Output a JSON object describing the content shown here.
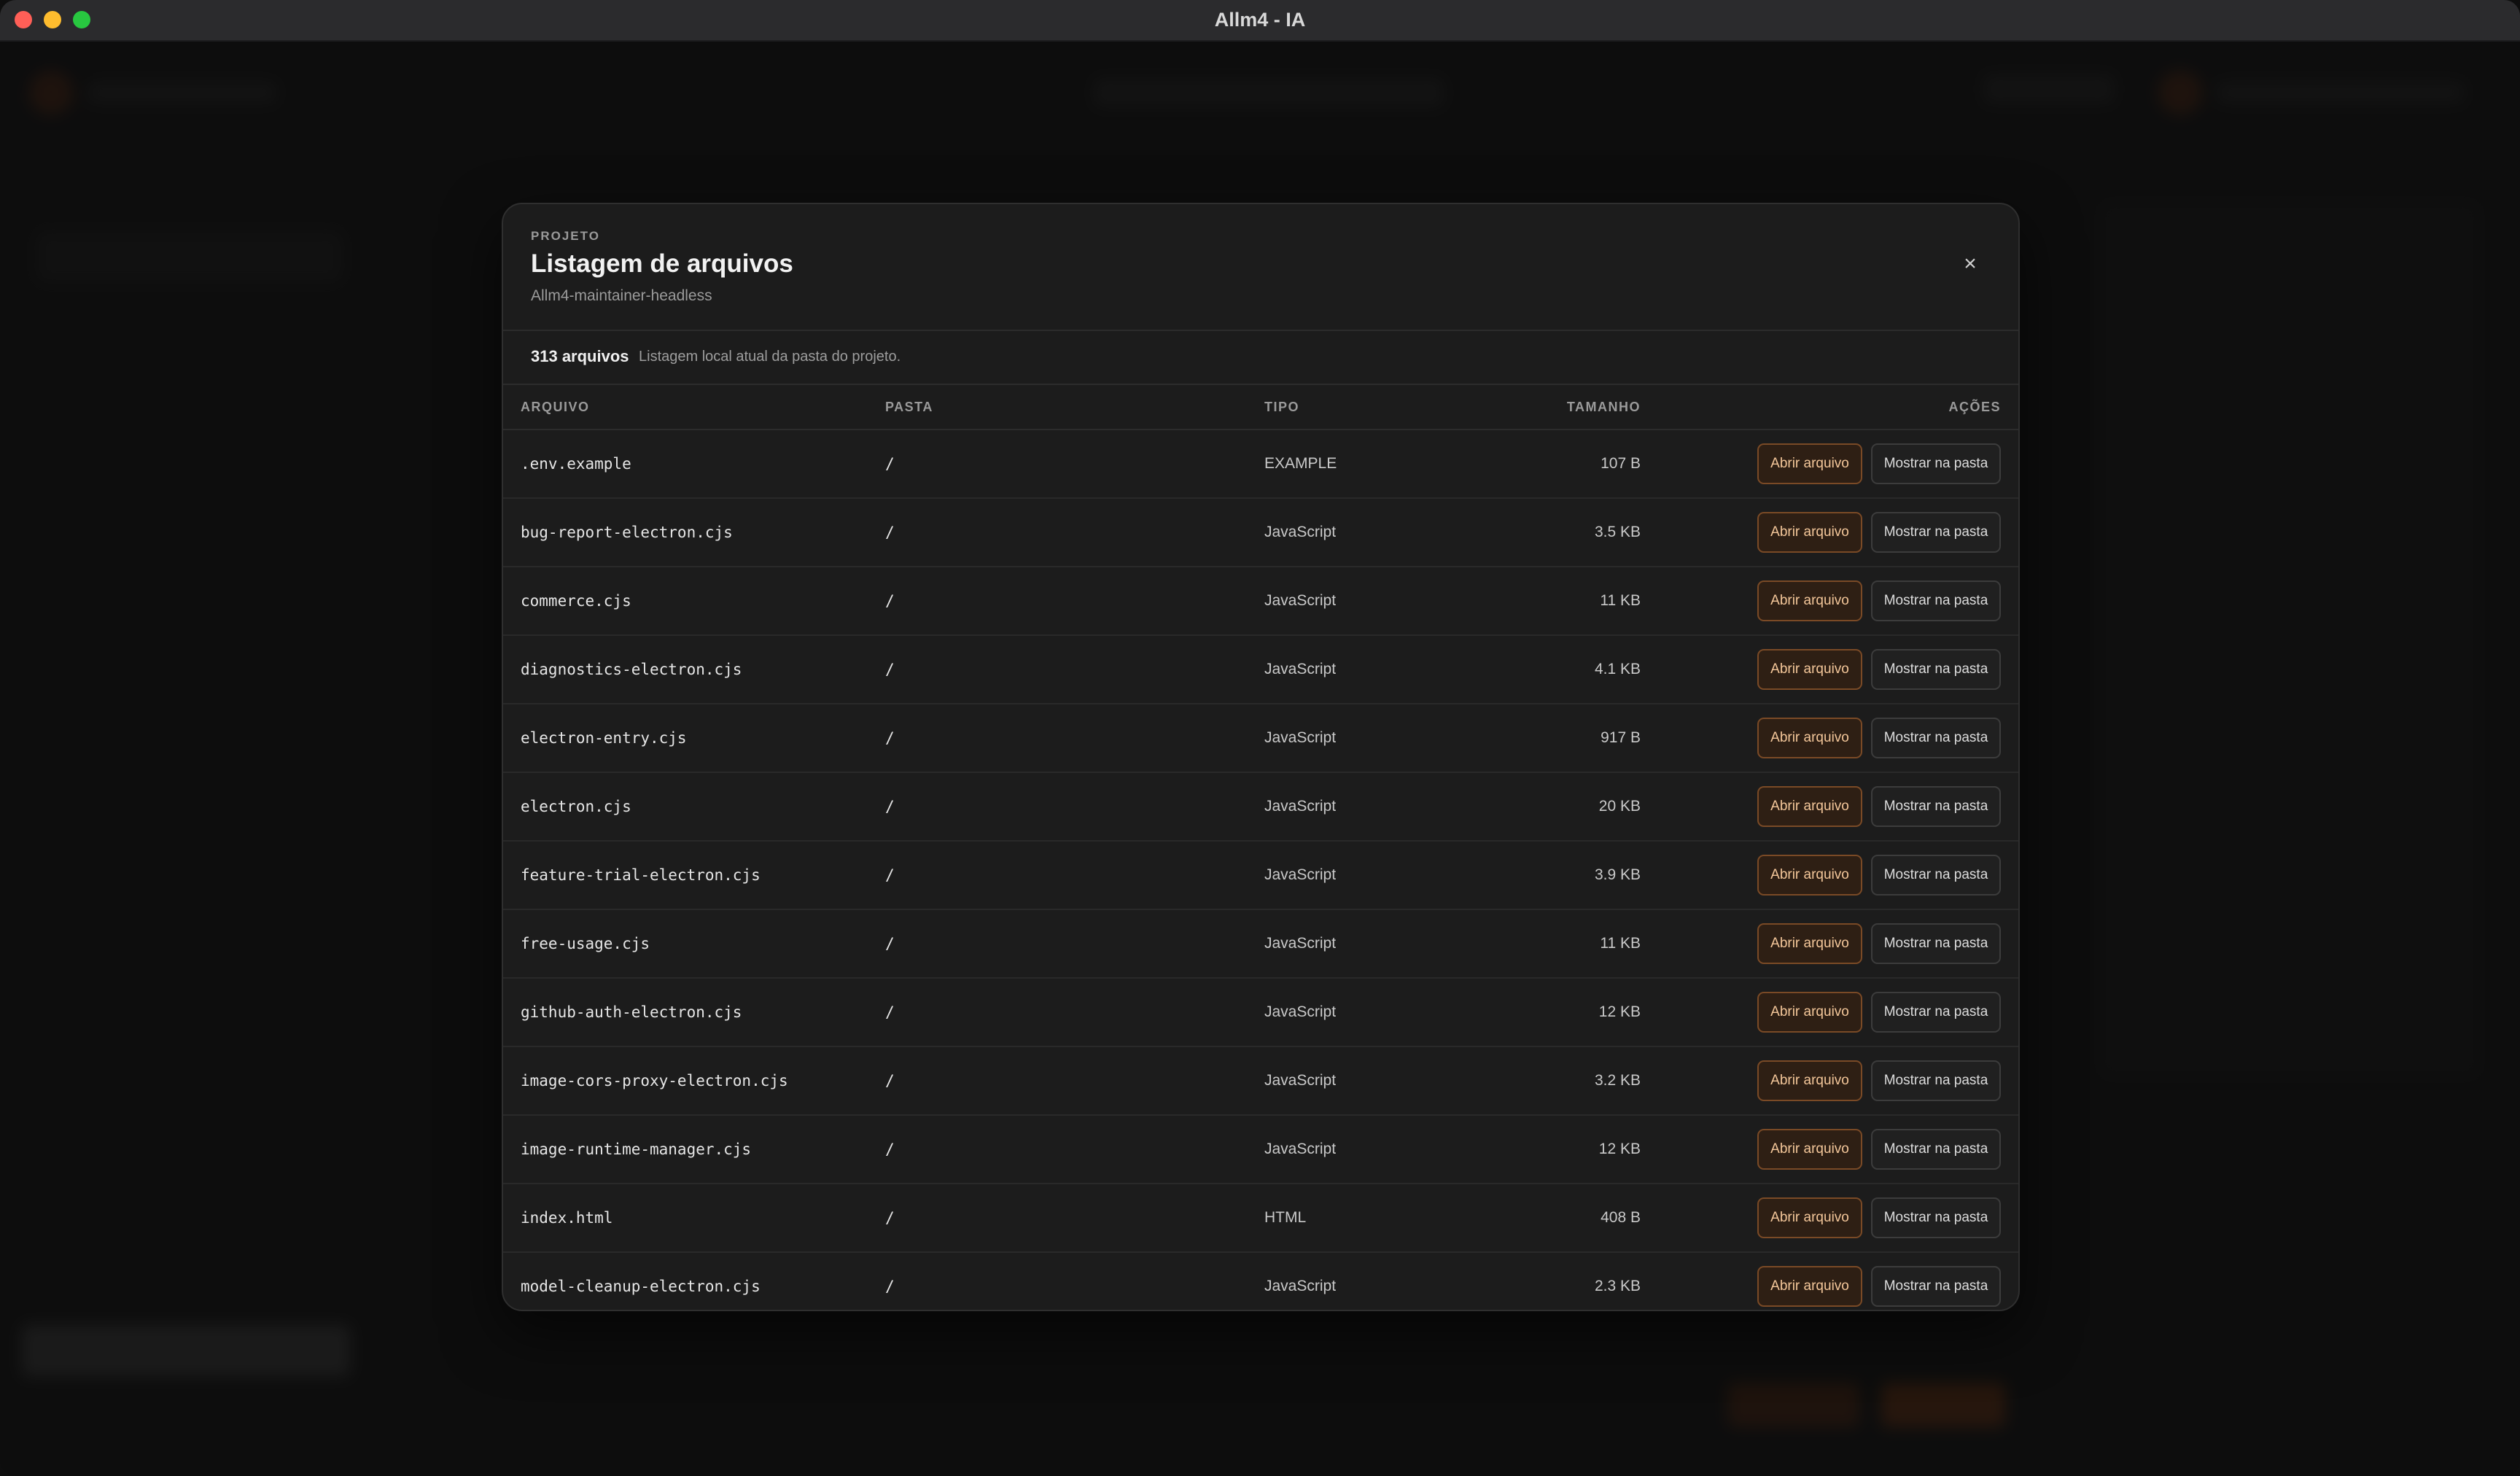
{
  "window": {
    "title": "Allm4 - IA"
  },
  "modal": {
    "eyebrow": "PROJETO",
    "title": "Listagem de arquivos",
    "subtitle": "Allm4-maintainer-headless",
    "close_label": "×",
    "summary": {
      "count": "313 arquivos",
      "description": "Listagem local atual da pasta do projeto."
    },
    "columns": {
      "file": "ARQUIVO",
      "folder": "PASTA",
      "type": "TIPO",
      "size": "TAMANHO",
      "actions": "AÇÕES"
    },
    "actions": {
      "open_label": "Abrir arquivo",
      "show_label": "Mostrar na pasta"
    },
    "rows": [
      {
        "file": ".env.example",
        "folder": "/",
        "type": "EXAMPLE",
        "size": "107 B"
      },
      {
        "file": "bug-report-electron.cjs",
        "folder": "/",
        "type": "JavaScript",
        "size": "3.5 KB"
      },
      {
        "file": "commerce.cjs",
        "folder": "/",
        "type": "JavaScript",
        "size": "11 KB"
      },
      {
        "file": "diagnostics-electron.cjs",
        "folder": "/",
        "type": "JavaScript",
        "size": "4.1 KB"
      },
      {
        "file": "electron-entry.cjs",
        "folder": "/",
        "type": "JavaScript",
        "size": "917 B"
      },
      {
        "file": "electron.cjs",
        "folder": "/",
        "type": "JavaScript",
        "size": "20 KB"
      },
      {
        "file": "feature-trial-electron.cjs",
        "folder": "/",
        "type": "JavaScript",
        "size": "3.9 KB"
      },
      {
        "file": "free-usage.cjs",
        "folder": "/",
        "type": "JavaScript",
        "size": "11 KB"
      },
      {
        "file": "github-auth-electron.cjs",
        "folder": "/",
        "type": "JavaScript",
        "size": "12 KB"
      },
      {
        "file": "image-cors-proxy-electron.cjs",
        "folder": "/",
        "type": "JavaScript",
        "size": "3.2 KB"
      },
      {
        "file": "image-runtime-manager.cjs",
        "folder": "/",
        "type": "JavaScript",
        "size": "12 KB"
      },
      {
        "file": "index.html",
        "folder": "/",
        "type": "HTML",
        "size": "408 B"
      },
      {
        "file": "model-cleanup-electron.cjs",
        "folder": "/",
        "type": "JavaScript",
        "size": "2.3 KB"
      }
    ]
  }
}
